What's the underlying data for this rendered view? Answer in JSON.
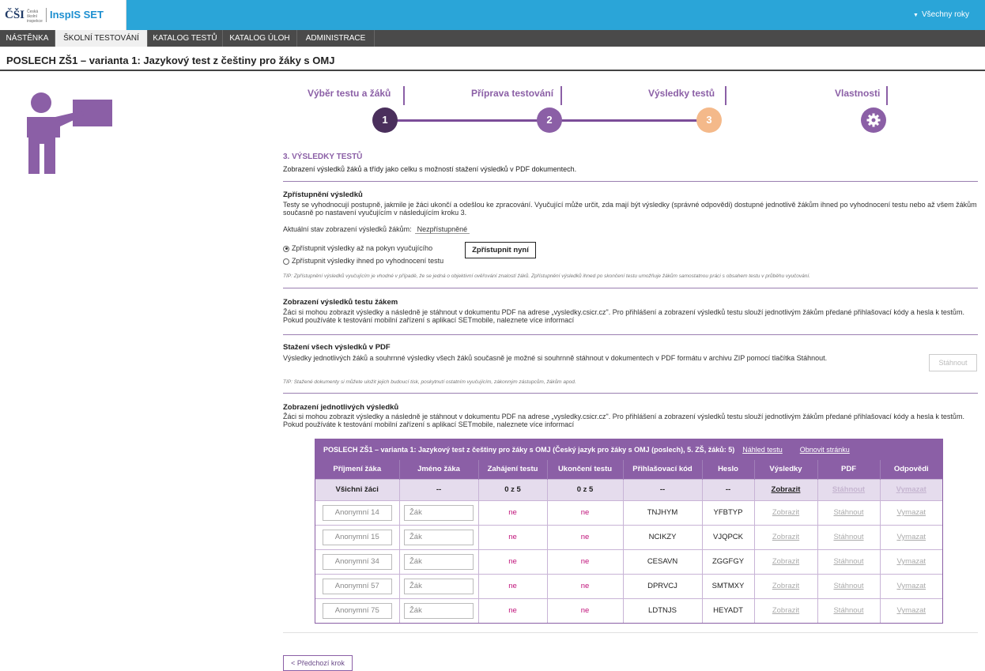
{
  "header": {
    "logo_text": "ČŠI",
    "logo_small": "Česká školní inspekce",
    "app_name": "InspIS SET",
    "years_label": "Všechny roky"
  },
  "nav": [
    {
      "label": "NÁSTĚNKA",
      "active": false
    },
    {
      "label": "ŠKOLNÍ TESTOVÁNÍ",
      "active": true
    },
    {
      "label": "KATALOG TESTŮ",
      "active": false
    },
    {
      "label": "KATALOG ÚLOH",
      "active": false
    },
    {
      "label": "ADMINISTRACE",
      "active": false
    }
  ],
  "page_title": "POSLECH ZŠ1 – varianta 1: Jazykový test z češtiny pro žáky s OMJ",
  "steps": [
    {
      "label": "Výběr testu a žáků",
      "number": "1",
      "color": "#4a2f5c"
    },
    {
      "label": "Příprava testování",
      "number": "2",
      "color": "#8b5fa6"
    },
    {
      "label": "Výsledky testů",
      "number": "3",
      "color": "#f4b98a"
    },
    {
      "label": "Vlastnosti",
      "number": "",
      "color": "#8b5fa6"
    }
  ],
  "section": {
    "heading": "3. VÝSLEDKY TESTŮ",
    "subheading": "Zobrazení výsledků žáků a třídy jako celku s možností stažení výsledků v PDF dokumentech."
  },
  "access": {
    "heading": "Zpřístupnění výsledků",
    "text": "Testy se vyhodnocují postupně, jakmile je žáci ukončí a odešlou ke zpracování. Vyučující může určit, zda mají být výsledky (správné odpovědi) dostupné jednotlivě žákům ihned po vyhodnocení testu nebo až všem žákům současně po nastavení vyučujícím v následujícím kroku 3.",
    "status_label": "Aktuální stav zobrazení výsledků žákům:",
    "status_value": "Nezpřístupněné",
    "radio1": "Zpřístupnit výsledky až na pokyn vyučujícího",
    "radio2": "Zpřístupnit výsledky ihned po vyhodnocení testu",
    "button": "Zpřístupnit nyní",
    "tip": "TIP: Zpřístupnění výsledků vyučujícím je vhodné v případě, že se jedná o objektivní ověřování znalostí žáků. Zpřístupnění výsledků ihned po skončení testu umožňuje žákům samostatnou práci s obsahem testu v průběhu vyučování."
  },
  "display": {
    "heading": "Zobrazení výsledků testu žákem",
    "text": "Žáci si mohou zobrazit výsledky a následně je stáhnout v dokumentu PDF na adrese „vysledky.csicr.cz\". Pro přihlášení a zobrazení výsledků testu slouží jednotlivým žákům předané přihlašovací kódy a hesla k testům. Pokud používáte k testování mobilní zařízení s aplikací SETmobile, naleznete více informací"
  },
  "download": {
    "heading": "Stažení všech výsledků v PDF",
    "text": "Výsledky jednotlivých žáků a souhrnné výsledky všech žáků současně je možné si souhrnně stáhnout v dokumentech v PDF formátu v archivu ZIP pomocí tlačítka Stáhnout.",
    "button": "Stáhnout",
    "tip": "TIP: Stažené dokumenty si můžete uložit jejich budoucí tisk, poskytnutí ostatním vyučujícím, zákonným zástupcům, žákům apod."
  },
  "individual": {
    "heading": "Zobrazení jednotlivých výsledků",
    "text": "Žáci si mohou zobrazit výsledky a následně je stáhnout v dokumentu PDF na adrese „vysledky.csicr.cz\". Pro přihlášení a zobrazení výsledků testu slouží jednotlivým žákům předané přihlašovací kódy a hesla k testům. Pokud používáte k testování mobilní zařízení s aplikací SETmobile, naleznete více informací"
  },
  "table": {
    "caption": "POSLECH ZŠ1 – varianta 1: Jazykový test z češtiny pro žáky s OMJ (Český jazyk pro žáky s OMJ (poslech), 5. ZŠ, žáků: 5)",
    "preview_link": "Náhled testu",
    "refresh_link": "Obnovit stránku",
    "columns": [
      "Příjmení žáka",
      "Jméno žáka",
      "Zahájení testu",
      "Ukončení testu",
      "Přihlašovací kód",
      "Heslo",
      "Výsledky",
      "PDF",
      "Odpovědi"
    ],
    "summary": {
      "label": "Všichni žáci",
      "first": "--",
      "start": "0 z 5",
      "end": "0 z 5",
      "code": "--",
      "password": "--",
      "results": "Zobrazit",
      "pdf": "Stáhnout",
      "answers": "Vymazat"
    },
    "rows": [
      {
        "surname": "Anonymní 14",
        "name": "Žák",
        "start": "ne",
        "end": "ne",
        "code": "TNJHYM",
        "password": "YFBTYP",
        "results": "Zobrazit",
        "pdf": "Stáhnout",
        "answers": "Vymazat"
      },
      {
        "surname": "Anonymní 15",
        "name": "Žák",
        "start": "ne",
        "end": "ne",
        "code": "NCIKZY",
        "password": "VJQPCK",
        "results": "Zobrazit",
        "pdf": "Stáhnout",
        "answers": "Vymazat"
      },
      {
        "surname": "Anonymní 34",
        "name": "Žák",
        "start": "ne",
        "end": "ne",
        "code": "CESAVN",
        "password": "ZGGFGY",
        "results": "Zobrazit",
        "pdf": "Stáhnout",
        "answers": "Vymazat"
      },
      {
        "surname": "Anonymní 57",
        "name": "Žák",
        "start": "ne",
        "end": "ne",
        "code": "DPRVCJ",
        "password": "SMTMXY",
        "results": "Zobrazit",
        "pdf": "Stáhnout",
        "answers": "Vymazat"
      },
      {
        "surname": "Anonymní 75",
        "name": "Žák",
        "start": "ne",
        "end": "ne",
        "code": "LDTNJS",
        "password": "HEYADT",
        "results": "Zobrazit",
        "pdf": "Stáhnout",
        "answers": "Vymazat"
      }
    ]
  },
  "prev_button": "< Předchozí krok"
}
